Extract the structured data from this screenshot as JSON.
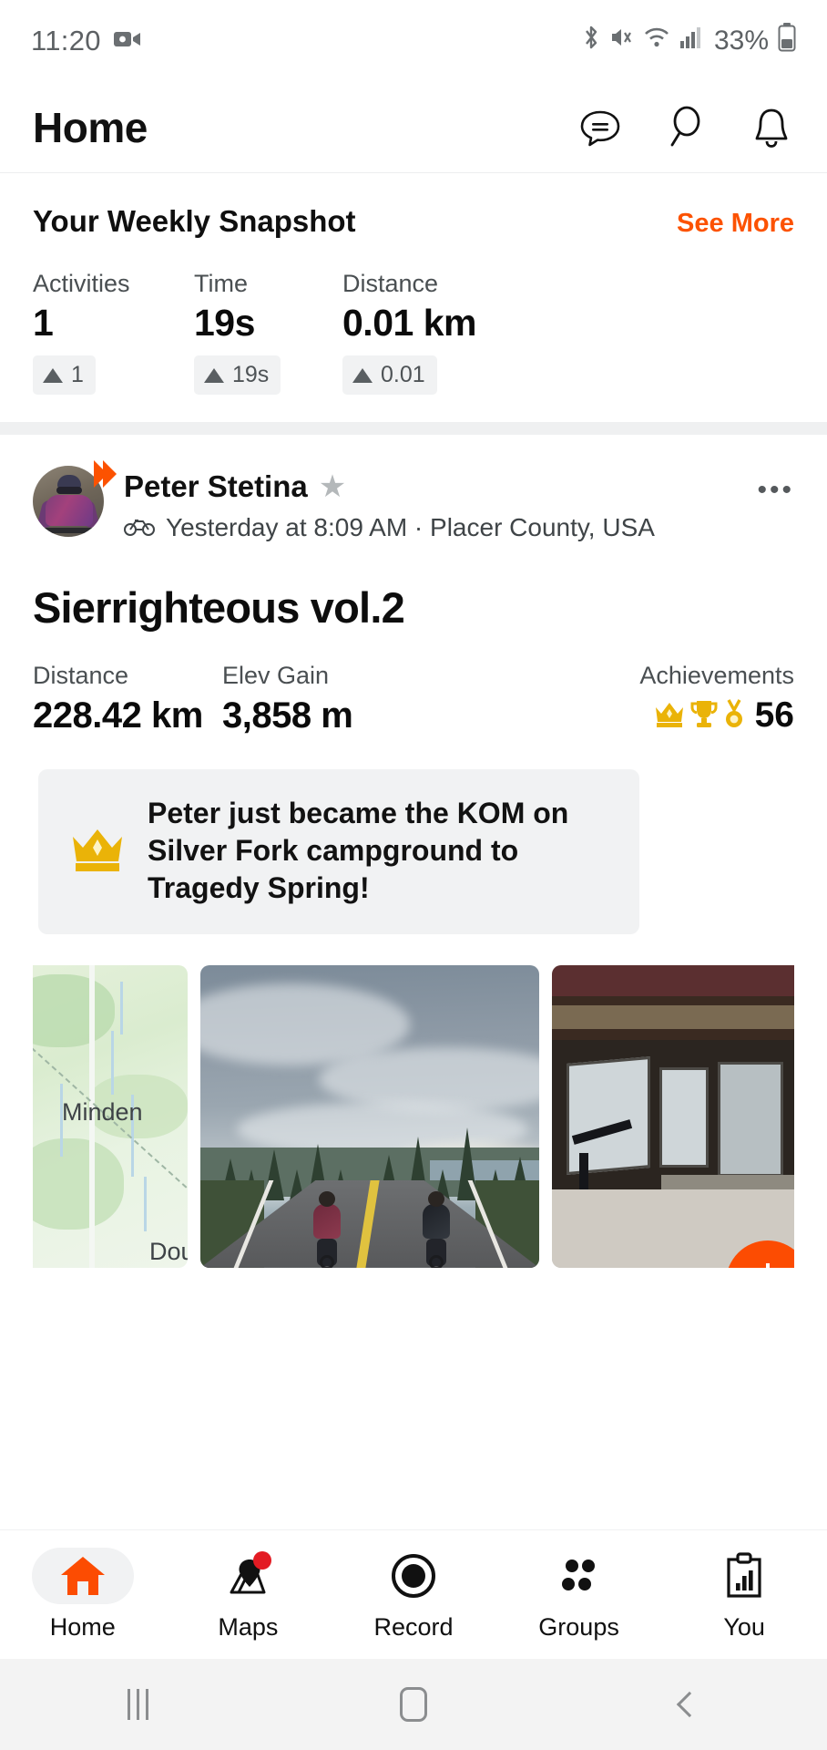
{
  "status_bar": {
    "time": "11:20",
    "battery_percent": "33%",
    "icons": [
      "video-record-icon",
      "bluetooth-icon",
      "mute-icon",
      "wifi-icon",
      "cellular-signal-icon",
      "battery-icon"
    ]
  },
  "header": {
    "title": "Home",
    "actions": [
      {
        "name": "messages-icon"
      },
      {
        "name": "search-icon"
      },
      {
        "name": "notifications-bell-icon"
      }
    ]
  },
  "snapshot": {
    "title": "Your Weekly Snapshot",
    "see_more_label": "See More",
    "accent_color": "#fc5200",
    "stats": [
      {
        "label": "Activities",
        "value": "1",
        "delta": "1",
        "trend": "up"
      },
      {
        "label": "Time",
        "value": "19s",
        "delta": "19s",
        "trend": "up"
      },
      {
        "label": "Distance",
        "value": "0.01 km",
        "delta": "0.01",
        "trend": "up"
      }
    ]
  },
  "activity": {
    "athlete_name": "Peter Stetina",
    "verified_star": "★",
    "sport_icon": "bicycle-icon",
    "subtitle": "Yesterday at 8:09 AM · Placer County, USA",
    "more_label": "•••",
    "title": "Sierrighteous vol.2",
    "stats": [
      {
        "label": "Distance",
        "value": "228.42 km"
      },
      {
        "label": "Elev Gain",
        "value": "3,858 m"
      }
    ],
    "achievements": {
      "label": "Achievements",
      "count": "56",
      "icons": [
        "crown-icon",
        "trophy-icon",
        "medal-icon"
      ],
      "color": "#e8b川"
    },
    "kom_banner": {
      "icon": "crown-icon",
      "text": "Peter just became the KOM on Silver Fork campground to Tragedy Spring!"
    },
    "media": [
      {
        "type": "map",
        "name": "route-map-thumbnail",
        "labels": [
          "Minden",
          "Dou"
        ]
      },
      {
        "type": "photo",
        "name": "activity-photo-cyclists-road"
      },
      {
        "type": "photo",
        "name": "activity-photo-shop-exterior"
      }
    ]
  },
  "fab": {
    "name": "add-activity-fab",
    "glyph": "+",
    "color": "#fc4c02"
  },
  "bottom_nav": {
    "items": [
      {
        "label": "Home",
        "icon": "home-icon",
        "active": true,
        "badge": false
      },
      {
        "label": "Maps",
        "icon": "map-pin-icon",
        "active": false,
        "badge": true
      },
      {
        "label": "Record",
        "icon": "record-circle-icon",
        "active": false,
        "badge": false
      },
      {
        "label": "Groups",
        "icon": "groups-dots-icon",
        "active": false,
        "badge": false
      },
      {
        "label": "You",
        "icon": "clipboard-chart-icon",
        "active": false,
        "badge": false
      }
    ]
  },
  "android_nav": {
    "recents": "recents-icon",
    "home": "home-square-icon",
    "back": "back-chevron-icon"
  }
}
